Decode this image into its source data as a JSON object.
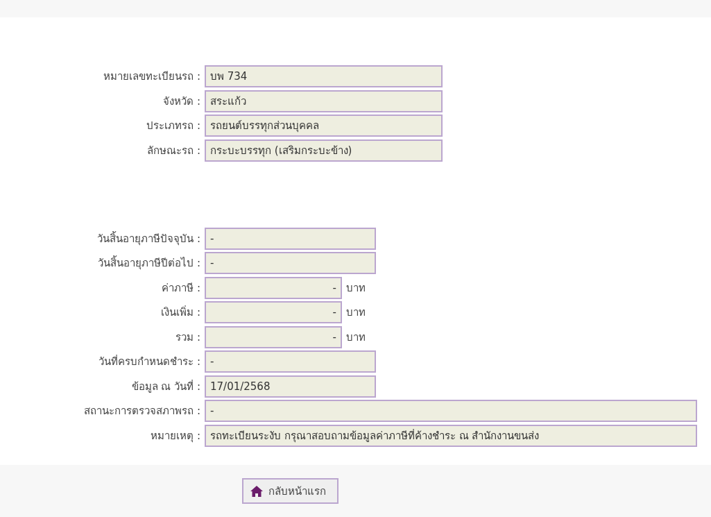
{
  "vehicle": [
    {
      "label": "หมายเลขทะเบียนรถ :",
      "value": "บพ 734",
      "kind": "medium"
    },
    {
      "label": "จังหวัด :",
      "value": "สระแก้ว",
      "kind": "medium"
    },
    {
      "label": "ประเภทรถ :",
      "value": "รถยนต์บรรทุกส่วนบุคคล",
      "kind": "medium"
    },
    {
      "label": "ลักษณะรถ :",
      "value": "กระบะบรรทุก (เสริมกระบะข้าง)",
      "kind": "medium"
    }
  ],
  "tax": [
    {
      "label": "วันสิ้นอายุภาษีปัจจุบัน :",
      "value": "-",
      "kind": "short"
    },
    {
      "label": "วันสิ้นอายุภาษีปีต่อไป :",
      "value": "-",
      "kind": "short"
    },
    {
      "label": "ค่าภาษี :",
      "value": "-",
      "kind": "amount",
      "unit": "บาท"
    },
    {
      "label": "เงินเพิ่ม :",
      "value": "-",
      "kind": "amount",
      "unit": "บาท"
    },
    {
      "label": "รวม :",
      "value": "-",
      "kind": "amount",
      "unit": "บาท"
    },
    {
      "label": "วันที่ครบกำหนดชำระ :",
      "value": "-",
      "kind": "short"
    },
    {
      "label": "ข้อมูล ณ วันที่ :",
      "value": "17/01/2568",
      "kind": "short"
    },
    {
      "label": "สถานะการตรวจสภาพรถ :",
      "value": "-",
      "kind": "wide"
    },
    {
      "label": "หมายเหตุ :",
      "value": "รถทะเบียนระงับ กรุณาสอบถามข้อมูลค่าภาษีที่ค้างชำระ ณ สำนักงานขนส่ง",
      "kind": "wide"
    }
  ],
  "home_button": {
    "label": "กลับหน้าแรก"
  }
}
